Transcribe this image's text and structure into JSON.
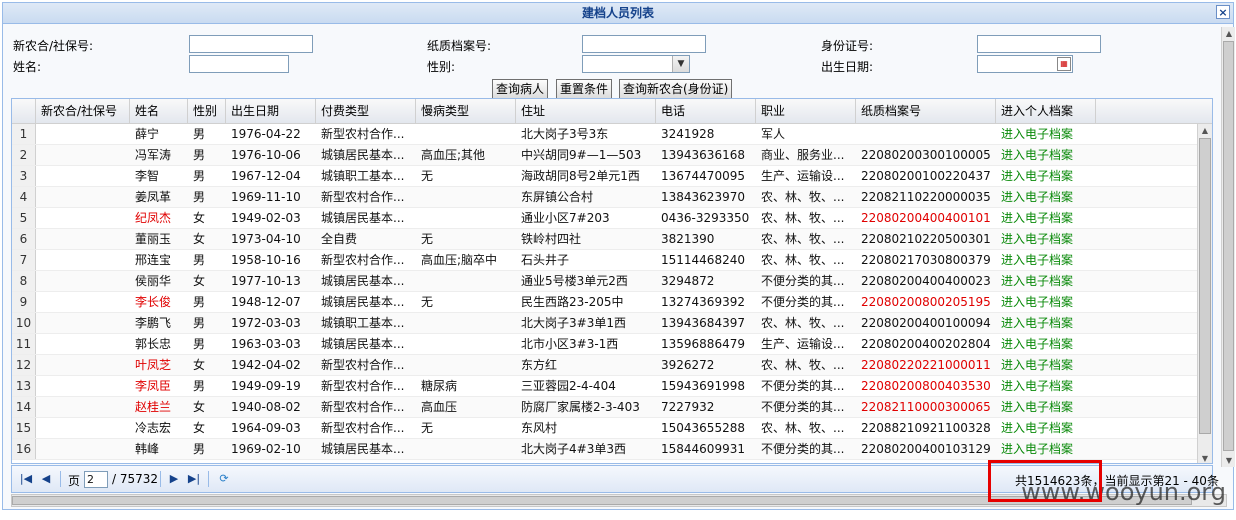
{
  "window": {
    "title": "建档人员列表",
    "close_label": "×"
  },
  "form": {
    "ncms_label": "新农合/社保号:",
    "archive_label": "纸质档案号:",
    "idcard_label": "身份证号:",
    "name_label": "姓名:",
    "gender_label": "性别:",
    "birth_label": "出生日期:",
    "ncms_value": "",
    "archive_value": "",
    "idcard_value": "",
    "name_value": "",
    "gender_value": "",
    "birth_value": "",
    "btn_query": "查询病人",
    "btn_reset": "重置条件",
    "btn_query_ncms": "查询新农合(身份证)"
  },
  "grid": {
    "columns": [
      "新农合/社保号",
      "姓名",
      "性别",
      "出生日期",
      "付费类型",
      "慢病类型",
      "住址",
      "电话",
      "职业",
      "纸质档案号",
      "进入个人档案"
    ],
    "rows": [
      {
        "n": "1",
        "ncms": "",
        "name": "薛宁",
        "gender": "男",
        "birth": "1976-04-22",
        "pay": "新型农村合作...",
        "chronic": "",
        "addr": "北大岗子3号3东",
        "phone": "3241928",
        "job": "军人",
        "archive": "",
        "link": "进入电子档案",
        "red_name": false,
        "red_archive": false
      },
      {
        "n": "2",
        "ncms": "",
        "name": "冯军涛",
        "gender": "男",
        "birth": "1976-10-06",
        "pay": "城镇居民基本...",
        "chronic": "高血压;其他",
        "addr": "中兴胡同9#—1—503",
        "phone": "13943636168",
        "job": "商业、服务业...",
        "archive": "22080200300100005",
        "link": "进入电子档案",
        "red_name": false,
        "red_archive": false
      },
      {
        "n": "3",
        "ncms": "",
        "name": "李智",
        "gender": "男",
        "birth": "1967-12-04",
        "pay": "城镇职工基本...",
        "chronic": "无",
        "addr": "海政胡同8号2单元1西",
        "phone": "13674470095",
        "job": "生产、运输设...",
        "archive": "22080200100220437",
        "link": "进入电子档案",
        "red_name": false,
        "red_archive": false
      },
      {
        "n": "4",
        "ncms": "",
        "name": "姜凤革",
        "gender": "男",
        "birth": "1969-11-10",
        "pay": "新型农村合作...",
        "chronic": "",
        "addr": "东屏镇公合村",
        "phone": "13843623970",
        "job": "农、林、牧、...",
        "archive": "22082110220000035",
        "link": "进入电子档案",
        "red_name": false,
        "red_archive": false
      },
      {
        "n": "5",
        "ncms": "",
        "name": "纪凤杰",
        "gender": "女",
        "birth": "1949-02-03",
        "pay": "城镇居民基本...",
        "chronic": "",
        "addr": "通业小区7#203",
        "phone": "0436-3293350",
        "job": "农、林、牧、...",
        "archive": "22080200400400101",
        "link": "进入电子档案",
        "red_name": true,
        "red_archive": true
      },
      {
        "n": "6",
        "ncms": "",
        "name": "董丽玉",
        "gender": "女",
        "birth": "1973-04-10",
        "pay": "全自费",
        "chronic": "无",
        "addr": "铁岭村四社",
        "phone": "3821390",
        "job": "农、林、牧、...",
        "archive": "22080210220500301",
        "link": "进入电子档案",
        "red_name": false,
        "red_archive": false
      },
      {
        "n": "7",
        "ncms": "",
        "name": "邢连宝",
        "gender": "男",
        "birth": "1958-10-16",
        "pay": "新型农村合作...",
        "chronic": "高血压;脑卒中",
        "addr": "石头井子",
        "phone": "15114468240",
        "job": "农、林、牧、...",
        "archive": "22080217030800379",
        "link": "进入电子档案",
        "red_name": false,
        "red_archive": false
      },
      {
        "n": "8",
        "ncms": "",
        "name": "侯丽华",
        "gender": "女",
        "birth": "1977-10-13",
        "pay": "城镇居民基本...",
        "chronic": "",
        "addr": "通业5号楼3单元2西",
        "phone": "3294872",
        "job": "不便分类的其...",
        "archive": "22080200400400023",
        "link": "进入电子档案",
        "red_name": false,
        "red_archive": false
      },
      {
        "n": "9",
        "ncms": "",
        "name": "李长俊",
        "gender": "男",
        "birth": "1948-12-07",
        "pay": "城镇居民基本...",
        "chronic": "无",
        "addr": "民生西路23-205中",
        "phone": "13274369392",
        "job": "不便分类的其...",
        "archive": "22080200800205195",
        "link": "进入电子档案",
        "red_name": true,
        "red_archive": true
      },
      {
        "n": "10",
        "ncms": "",
        "name": "李鹏飞",
        "gender": "男",
        "birth": "1972-03-03",
        "pay": "城镇职工基本...",
        "chronic": "",
        "addr": "北大岗子3#3单1西",
        "phone": "13943684397",
        "job": "农、林、牧、...",
        "archive": "22080200400100094",
        "link": "进入电子档案",
        "red_name": false,
        "red_archive": false
      },
      {
        "n": "11",
        "ncms": "",
        "name": "郭长忠",
        "gender": "男",
        "birth": "1963-03-03",
        "pay": "城镇居民基本...",
        "chronic": "",
        "addr": "北市小区3#3-1西",
        "phone": "13596886479",
        "job": "生产、运输设...",
        "archive": "22080200400202804",
        "link": "进入电子档案",
        "red_name": false,
        "red_archive": false
      },
      {
        "n": "12",
        "ncms": "",
        "name": "叶凤芝",
        "gender": "女",
        "birth": "1942-04-02",
        "pay": "新型农村合作...",
        "chronic": "",
        "addr": "东方红",
        "phone": "3926272",
        "job": "农、林、牧、...",
        "archive": "22080220221000011",
        "link": "进入电子档案",
        "red_name": true,
        "red_archive": true
      },
      {
        "n": "13",
        "ncms": "",
        "name": "李凤臣",
        "gender": "男",
        "birth": "1949-09-19",
        "pay": "新型农村合作...",
        "chronic": "糖尿病",
        "addr": "三亚蓉园2-4-404",
        "phone": "15943691998",
        "job": "不便分类的其...",
        "archive": "22080200800403530",
        "link": "进入电子档案",
        "red_name": true,
        "red_archive": true
      },
      {
        "n": "14",
        "ncms": "",
        "name": "赵桂兰",
        "gender": "女",
        "birth": "1940-08-02",
        "pay": "新型农村合作...",
        "chronic": "高血压",
        "addr": "防腐厂家属楼2-3-403",
        "phone": "7227932",
        "job": "不便分类的其...",
        "archive": "22082110000300065",
        "link": "进入电子档案",
        "red_name": true,
        "red_archive": true
      },
      {
        "n": "15",
        "ncms": "",
        "name": "冷志宏",
        "gender": "女",
        "birth": "1964-09-03",
        "pay": "新型农村合作...",
        "chronic": "无",
        "addr": "东风村",
        "phone": "15043655288",
        "job": "农、林、牧、...",
        "archive": "22088210921100328",
        "link": "进入电子档案",
        "red_name": false,
        "red_archive": false
      },
      {
        "n": "16",
        "ncms": "",
        "name": "韩峰",
        "gender": "男",
        "birth": "1969-02-10",
        "pay": "城镇居民基本...",
        "chronic": "",
        "addr": "北大岗子4#3单3西",
        "phone": "15844609931",
        "job": "不便分类的其...",
        "archive": "22080200400103129",
        "link": "进入电子档案",
        "red_name": false,
        "red_archive": false
      }
    ]
  },
  "pager": {
    "page_label": "页",
    "page_value": "2",
    "total_pages": "/ 75732",
    "summary": "共1514623条，当前显示第21 - 40条"
  },
  "watermark": "www.wooyun.org",
  "colors": {
    "title": "#15428b",
    "red_text": "#e00000",
    "link_green": "#0a8a0a",
    "highlight_box": "#e60000"
  }
}
